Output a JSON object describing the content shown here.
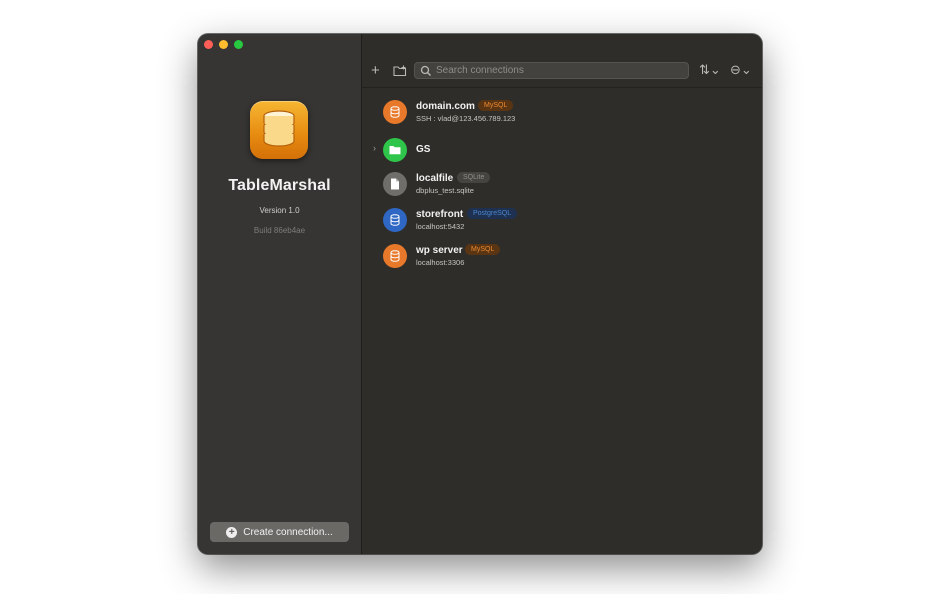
{
  "window": {
    "traffic_lights": {
      "close": "#ff5f57",
      "minimize": "#febc2e",
      "maximize": "#28c840"
    }
  },
  "sidebar": {
    "app_icon": "database-icon",
    "app_name": "TableMarshal",
    "version": "Version 1.0",
    "build": "Build 86eb4ae",
    "create_button_label": "Create connection..."
  },
  "toolbar": {
    "add_icon": "+",
    "new_folder_icon": "folder-plus-icon",
    "search_placeholder": "Search connections",
    "sort_label": "⇅⌄",
    "more_label": "⊖⌄"
  },
  "connections": [
    {
      "name": "domain.com",
      "badge": "MySQL",
      "subtitle": "SSH : vlad@123.456.789.123",
      "icon": "database-icon",
      "color": "#e8792a"
    },
    {
      "name": "GS",
      "type": "folder",
      "icon": "folder-icon",
      "color": "#2fc44a",
      "chevron": "›"
    },
    {
      "name": "localfile",
      "badge": "SQLite",
      "subtitle": "dbplus_test.sqlite",
      "icon": "file-icon",
      "color": "#6f6e6a"
    },
    {
      "name": "storefront",
      "badge": "PostgreSQL",
      "subtitle": "localhost:5432",
      "icon": "database-icon",
      "color": "#2f67c4"
    },
    {
      "name": "wp server",
      "badge": "MySQL",
      "subtitle": "localhost:3306",
      "icon": "database-icon",
      "color": "#e8792a"
    }
  ]
}
